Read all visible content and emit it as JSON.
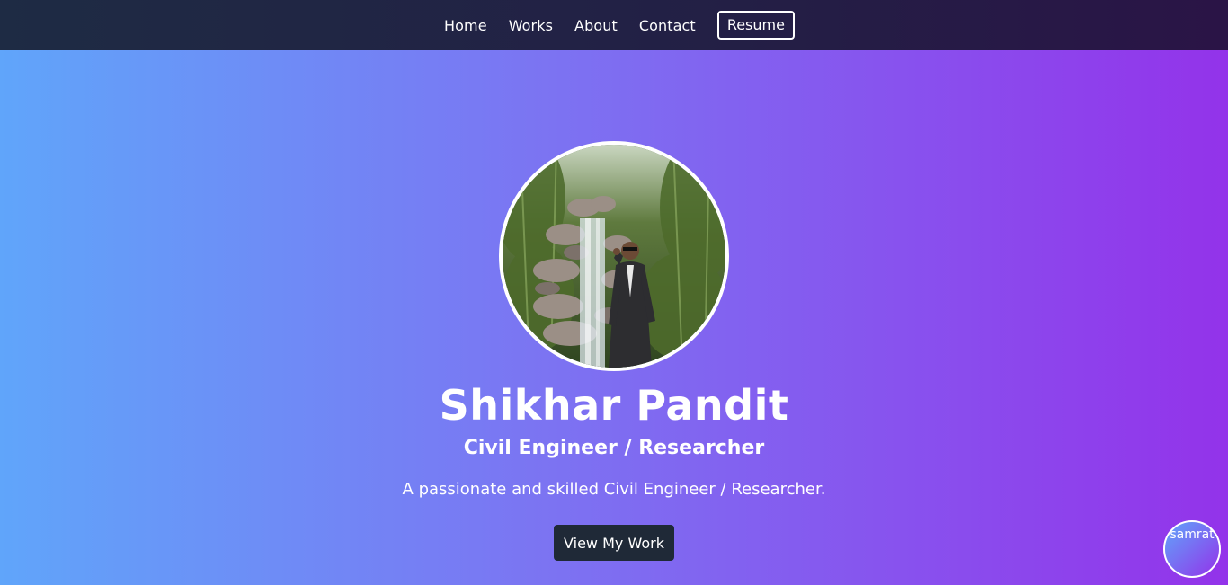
{
  "nav": {
    "links": [
      {
        "label": "Home"
      },
      {
        "label": "Works"
      },
      {
        "label": "About"
      },
      {
        "label": "Contact"
      }
    ],
    "resume_label": "Resume"
  },
  "hero": {
    "name": "Shikhar Pandit",
    "role": "Civil Engineer / Researcher",
    "description": "A passionate and skilled Civil Engineer / Researcher.",
    "cta_label": "View My Work",
    "avatar_alt": "profile-photo"
  },
  "fab": {
    "label": "samrat"
  },
  "colors": {
    "nav_bg_start": "#1e2b44",
    "nav_bg_end": "#2a1446",
    "hero_gradient_start": "#60a5fa",
    "hero_gradient_end": "#9333ea",
    "cta_bg": "#1f2937",
    "text": "#ffffff"
  }
}
